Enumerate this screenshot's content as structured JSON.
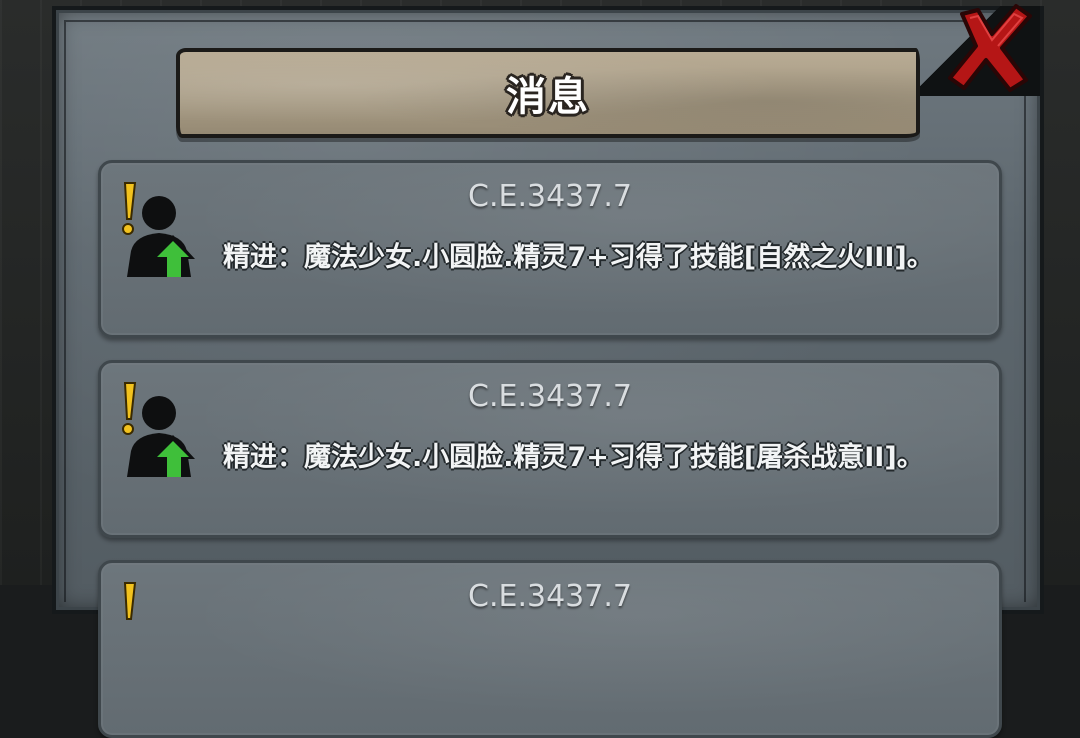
{
  "dialog": {
    "title": "消息"
  },
  "messages": [
    {
      "date": "C.E.3437.7",
      "text": "精进：魔法少女.小圆脸.精灵7+习得了技能[自然之火III]。",
      "icon": "skill-upgrade-icon"
    },
    {
      "date": "C.E.3437.7",
      "text": "精进：魔法少女.小圆脸.精灵7+习得了技能[屠杀战意II]。",
      "icon": "skill-upgrade-icon"
    },
    {
      "date": "C.E.3437.7",
      "text": "",
      "icon": "skill-upgrade-icon"
    }
  ],
  "colors": {
    "panel": "#5d676e",
    "plaque": "#a69a83",
    "close_red": "#c21818",
    "arrow_green": "#3fbf3a",
    "alert_yellow": "#f2c21e"
  }
}
